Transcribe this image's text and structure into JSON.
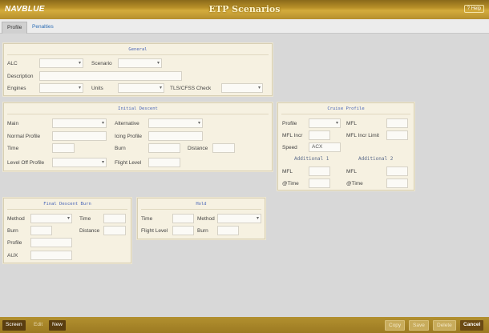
{
  "header": {
    "logo": "NAVBLUE",
    "title": "ETP Scenarios",
    "help": "Help"
  },
  "tabs": [
    {
      "label": "Profile"
    },
    {
      "label": "Penalties"
    }
  ],
  "general": {
    "title": "General",
    "alc_label": "ALC",
    "scenario_label": "Scenario",
    "description_label": "Description",
    "engines_label": "Engines",
    "units_label": "Units",
    "tls_label": "TLS/CFSS Check"
  },
  "initial_descent": {
    "title": "Initial Descent",
    "main_label": "Main",
    "alternative_label": "Alternative",
    "normal_profile_label": "Normal Profile",
    "icing_profile_label": "Icing Profile",
    "time_label": "Time",
    "burn_label": "Burn",
    "distance_label": "Distance",
    "level_off_profile_label": "Level Off Profile",
    "flight_level_label": "Flight Level"
  },
  "cruise_profile": {
    "title": "Cruise Profile",
    "profile_label": "Profile",
    "mfl_label": "MFL",
    "mfl_incr_label": "MFL Incr",
    "mfl_incr_limit_label": "MFL Incr Limit",
    "speed_label": "Speed",
    "speed_value": "ACX",
    "additional1_label": "Additional 1",
    "additional2_label": "Additional 2",
    "add1_mfl_label": "MFL",
    "add1_time_label": "@Time",
    "add2_mfl_label": "MFL",
    "add2_time_label": "@Time"
  },
  "final_descent": {
    "title": "Final Descent Burn",
    "method_label": "Method",
    "time_label": "Time",
    "burn_label": "Burn",
    "distance_label": "Distance",
    "profile_label": "Profile",
    "aux_label": "AUX"
  },
  "hold": {
    "title": "Hold",
    "time_label": "Time",
    "method_label": "Method",
    "flight_level_label": "Flight Level",
    "burn_label": "Burn"
  },
  "footer": {
    "screen": "Screen",
    "edit": "Edit",
    "new": "New",
    "copy": "Copy",
    "save": "Save",
    "delete": "Delete",
    "cancel": "Cancel"
  }
}
